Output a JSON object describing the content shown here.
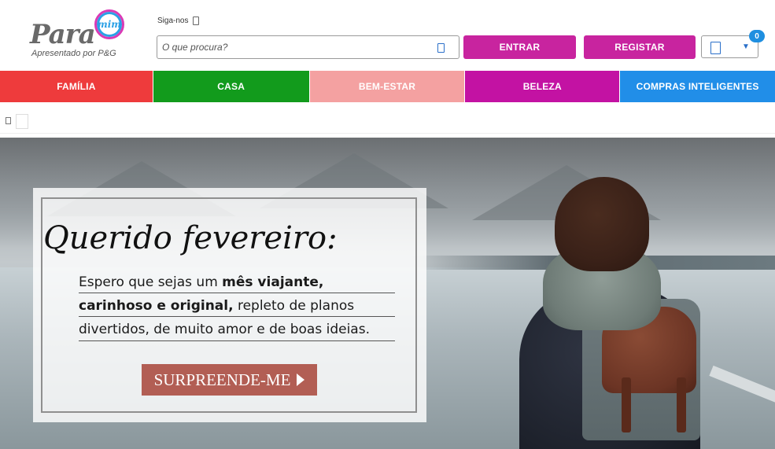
{
  "logo": {
    "word": "Para",
    "bubble": "mim",
    "tagline": "Apresentado por P&G"
  },
  "header": {
    "follow_label": "Siga-nos",
    "search": {
      "placeholder": "O que procura?"
    },
    "enter_label": "ENTRAR",
    "register_label": "REGISTAR",
    "cart_count": "0"
  },
  "nav": {
    "items": [
      {
        "label": "FAMÍLIA",
        "color": "#ee3b3c"
      },
      {
        "label": "CASA",
        "color": "#129b1c"
      },
      {
        "label": "BEM-ESTAR",
        "color": "#f4a1a1"
      },
      {
        "label": "BELEZA",
        "color": "#c312a3"
      },
      {
        "label": "COMPRAS INTELIGENTES",
        "color": "#218ee8"
      }
    ]
  },
  "hero": {
    "title": "Querido fevereiro:",
    "line1_regular": "Espero que sejas um ",
    "line1_bold": "mês viajante,",
    "line2_bold": "carinhoso e original,",
    "line2_regular": " repleto de planos",
    "line3": "divertidos, de muito amor e de boas ideias.",
    "cta_label": "SURPREENDE-ME"
  },
  "colors": {
    "brand_magenta": "#c8249f",
    "badge_blue": "#1f8fe0",
    "cta_brown": "#b25e54"
  }
}
